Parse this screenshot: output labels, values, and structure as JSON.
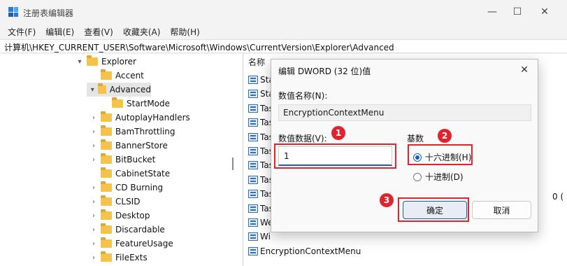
{
  "window": {
    "title": "注册表编辑器",
    "controls": {
      "minimize": "—",
      "maximize": "☐",
      "close": "✕"
    }
  },
  "menu": [
    "文件(F)",
    "编辑(E)",
    "查看(V)",
    "收藏夹(A)",
    "帮助(H)"
  ],
  "address": "计算机\\HKEY_CURRENT_USER\\Software\\Microsoft\\Windows\\CurrentVersion\\Explorer\\Advanced",
  "tree": {
    "items": [
      {
        "label": "Explorer",
        "chevron": "▾"
      },
      {
        "label": "Accent",
        "chevron": ""
      },
      {
        "label": "Advanced",
        "chevron": "▾",
        "selected": true
      },
      {
        "label": "StartMode",
        "chevron": ""
      },
      {
        "label": "AutoplayHandlers",
        "chevron": "›"
      },
      {
        "label": "BamThrottling",
        "chevron": "›"
      },
      {
        "label": "BannerStore",
        "chevron": "›"
      },
      {
        "label": "BitBucket",
        "chevron": "›"
      },
      {
        "label": "CabinetState",
        "chevron": ""
      },
      {
        "label": "CD Burning",
        "chevron": "›"
      },
      {
        "label": "CLSID",
        "chevron": "›"
      },
      {
        "label": "Desktop",
        "chevron": "›"
      },
      {
        "label": "Discardable",
        "chevron": "›"
      },
      {
        "label": "FeatureUsage",
        "chevron": "›"
      },
      {
        "label": "FileExts",
        "chevron": "›"
      }
    ]
  },
  "values": {
    "header": "名称",
    "rows": [
      "Sta",
      "Sta",
      "Tas",
      "Tas",
      "Tas",
      "Tas",
      "Tas",
      "Tas",
      "Tas",
      "Tas",
      "We",
      "Wi",
      "EncryptionContextMenu"
    ],
    "partial_right": "0 ("
  },
  "dialog": {
    "title": "编辑 DWORD (32 位)值",
    "name_label": "数值名称(N):",
    "name_value": "EncryptionContextMenu",
    "data_label": "数值数据(V):",
    "data_value": "1",
    "base_label": "基数",
    "hex_label": "十六进制(H)",
    "dec_label": "十进制(D)",
    "ok_label": "确定",
    "cancel_label": "取消",
    "close": "✕"
  },
  "callouts": [
    "1",
    "2",
    "3"
  ],
  "colors": {
    "callout_red": "#e0242e",
    "accent_blue": "#1a5fb4",
    "folder_yellow": "#f3c34b"
  }
}
